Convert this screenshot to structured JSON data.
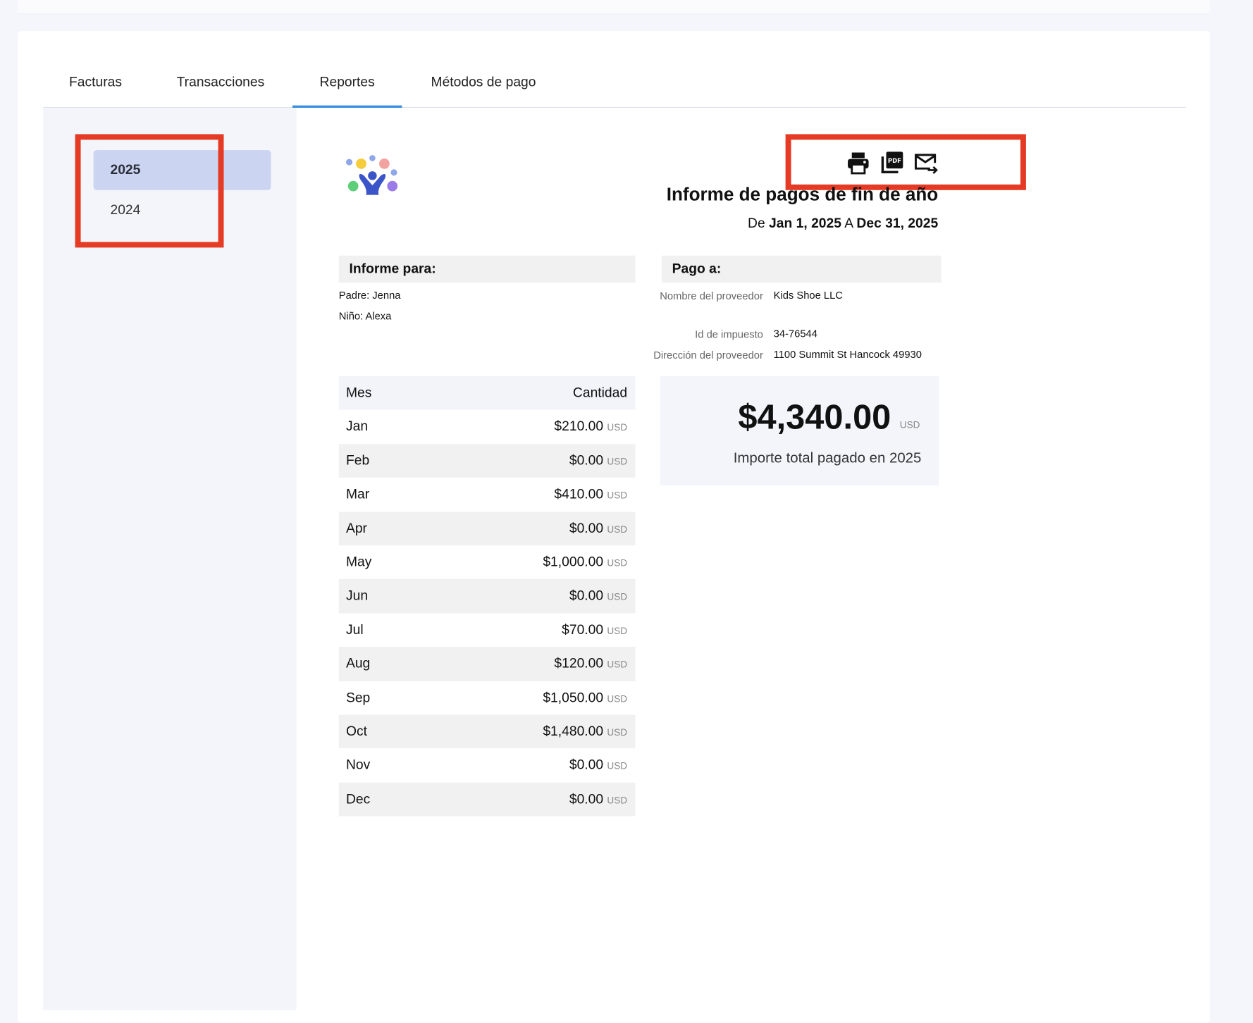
{
  "tabs": [
    {
      "label": "Facturas",
      "active": false
    },
    {
      "label": "Transacciones",
      "active": false
    },
    {
      "label": "Reportes",
      "active": true
    },
    {
      "label": "Métodos de pago",
      "active": false
    }
  ],
  "years": [
    {
      "label": "2025",
      "active": true
    },
    {
      "label": "2024",
      "active": false
    }
  ],
  "toolbar": {
    "icons": [
      "print-icon",
      "pdf-icon",
      "email-send-icon"
    ]
  },
  "report": {
    "title": "Informe de pagos de fin de año",
    "range_prefix": "De",
    "range_start": "Jan 1, 2025",
    "range_mid": "A",
    "range_end": "Dec 31, 2025"
  },
  "report_for": {
    "heading": "Informe para:",
    "parent": "Padre: Jenna",
    "child": "Niño: Alexa"
  },
  "pay_to": {
    "heading": "Pago a:",
    "provider_name_label": "Nombre del proveedor",
    "provider_name": "Kids Shoe LLC",
    "tax_id_label": "Id de impuesto",
    "tax_id": "34-76544",
    "address_label": "Dirección del proveedor",
    "address": "1100 Summit St Hancock 49930"
  },
  "table": {
    "col_month": "Mes",
    "col_amount": "Cantidad",
    "currency": "USD",
    "rows": [
      {
        "month": "Jan",
        "amount": "$210.00"
      },
      {
        "month": "Feb",
        "amount": "$0.00"
      },
      {
        "month": "Mar",
        "amount": "$410.00"
      },
      {
        "month": "Apr",
        "amount": "$0.00"
      },
      {
        "month": "May",
        "amount": "$1,000.00"
      },
      {
        "month": "Jun",
        "amount": "$0.00"
      },
      {
        "month": "Jul",
        "amount": "$70.00"
      },
      {
        "month": "Aug",
        "amount": "$120.00"
      },
      {
        "month": "Sep",
        "amount": "$1,050.00"
      },
      {
        "month": "Oct",
        "amount": "$1,480.00"
      },
      {
        "month": "Nov",
        "amount": "$0.00"
      },
      {
        "month": "Dec",
        "amount": "$0.00"
      }
    ]
  },
  "total": {
    "amount": "$4,340.00",
    "currency": "USD",
    "label": "Importe total pagado en 2025"
  },
  "colors": {
    "accent": "#3d8fe0",
    "highlight": "#e53a24",
    "selected_year_bg": "#cbd4f1",
    "logo_person": "#3b55c9"
  }
}
